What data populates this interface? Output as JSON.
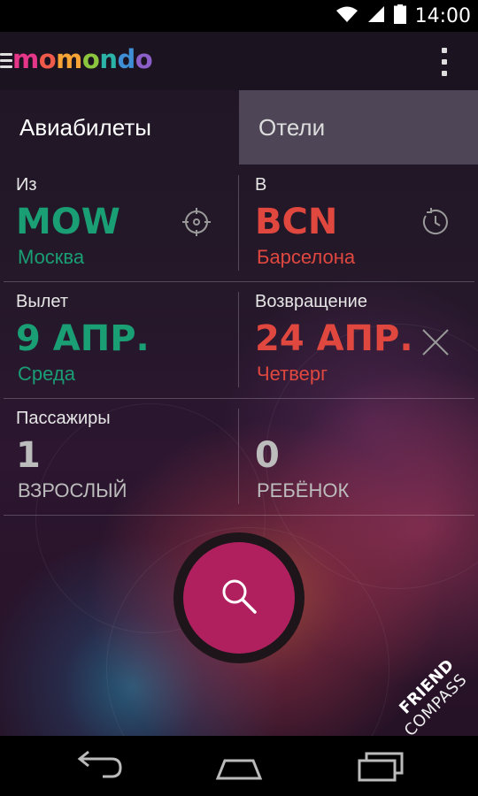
{
  "status_bar": {
    "time": "14:00"
  },
  "app_bar": {
    "logo_letters": [
      {
        "ch": "m",
        "color": "#e6368a"
      },
      {
        "ch": "o",
        "color": "#f05a4a"
      },
      {
        "ch": "m",
        "color": "#f7a335"
      },
      {
        "ch": "o",
        "color": "#8cc63f"
      },
      {
        "ch": "n",
        "color": "#2bb3a8"
      },
      {
        "ch": "d",
        "color": "#3f8fd6"
      },
      {
        "ch": "o",
        "color": "#8b5fc7"
      }
    ]
  },
  "tabs": {
    "flights": "Авиабилеты",
    "hotels": "Отели"
  },
  "from": {
    "label": "Из",
    "code": "MOW",
    "city": "Москва"
  },
  "to": {
    "label": "В",
    "code": "BCN",
    "city": "Барселона"
  },
  "departure": {
    "label": "Вылет",
    "date": "9 АПР.",
    "weekday": "Среда"
  },
  "return": {
    "label": "Возвращение",
    "date": "24 АПР.",
    "weekday": "Четверг"
  },
  "passengers": {
    "label": "Пассажиры",
    "adults_count": "1",
    "adults_label": "ВЗРОСЛЫЙ",
    "children_count": "0",
    "children_label": "РЕБЁНОК"
  },
  "badge": {
    "line1": "FRIEND",
    "line2": "COMPASS"
  },
  "colors": {
    "accent_green": "#1a9e74",
    "accent_red": "#e0483f",
    "search_button": "#b0205f"
  }
}
